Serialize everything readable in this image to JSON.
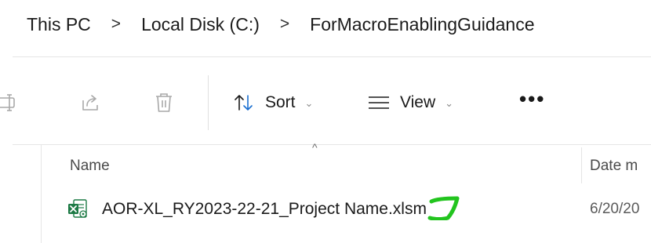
{
  "breadcrumb": {
    "items": [
      "This PC",
      "Local Disk (C:)",
      "ForMacroEnablingGuidance"
    ],
    "separator": ">"
  },
  "toolbar": {
    "rename_icon": "rename-icon",
    "share_icon": "share-icon",
    "delete_icon": "trash-icon",
    "sort_label": "Sort",
    "view_label": "View",
    "more_label": "•••",
    "caret": "⌄"
  },
  "file_list": {
    "columns": [
      "Name",
      "Date m"
    ],
    "sort_indicator": "^",
    "rows": [
      {
        "name": "AOR-XL_RY2023-22-21_Project Name.xlsm",
        "date": "6/20/20",
        "icon": "excel-macro-file-icon"
      }
    ]
  },
  "colors": {
    "excel_green": "#1d7a45",
    "annotation_green": "#22c41e",
    "disabled": "#a8a8a8"
  }
}
